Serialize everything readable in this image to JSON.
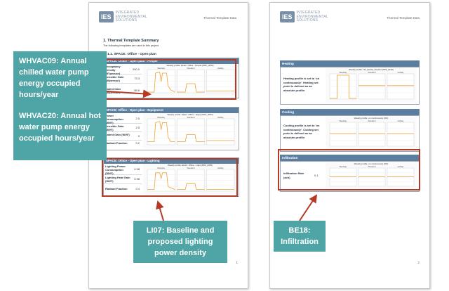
{
  "logo": {
    "mark": "IES",
    "line1": "INTEGRATED",
    "line2": "ENVIRONMENTAL",
    "line3": "SOLUTIONS"
  },
  "page1": {
    "header_right": "Thermal Template Data",
    "title": "1.  Thermal Template Summary",
    "intro": "The following templates are used in this project",
    "subheading": "1.1. SPACE: Office - Open plan",
    "page_number": "1",
    "tables": [
      {
        "title": "SPACE: Office - Open plan - People",
        "chart_title": "Weekly profile: ELEC: Office - People (PRF_0053)",
        "rows": [
          {
            "label": "Occupancy Density (ft²/person)",
            "value": "200.0"
          },
          {
            "label": "Sensible Gain (W/person)",
            "value": "73.3"
          },
          {
            "label": "Latent Gain (W/person)",
            "value": "58.6"
          }
        ]
      },
      {
        "title": "SPACE: Office - Open plan - Equipment",
        "chart_title": "Weekly profile: ELEC: Office - Equip (PRF_0054)",
        "rows": [
          {
            "label": "Power Consumption (W/ft²)",
            "value": "2.5"
          },
          {
            "label": "Sensible Gain (W/ft²)",
            "value": "2.5"
          },
          {
            "label": "Latent Gain (W/ft²)",
            "value": "0"
          },
          {
            "label": "Radiant Fraction",
            "value": "0.2"
          }
        ]
      },
      {
        "title": "SPACE: Office - Open plan - Lighting",
        "chart_title": "Weekly profile: ELEC: Office - Light (PRF_0055)",
        "rows": [
          {
            "label": "Lighting Power Consumption (W/ft²)",
            "value": "0.98"
          },
          {
            "label": "Lighting Heat Gain (W/ft²)",
            "value": "0.98"
          },
          {
            "label": "Radiant Fraction",
            "value": "0.4"
          }
        ]
      }
    ]
  },
  "page2": {
    "header_right": "Thermal Template Data",
    "page_number": "2",
    "sections": [
      {
        "title": "Heating",
        "text": "Heating profile is set to 'on continuously'. Heating set point is defined as an absolute profile:",
        "chart_title": "Weekly profile: UK_Hostel_Heatset (PRF_0193)"
      },
      {
        "title": "Cooling",
        "text": "Cooling profile is set to 'on continuously'. Cooling set point is defined as an absolute profile:",
        "chart_title": "Weekly profile: on continuously (ON)"
      },
      {
        "title": "Infiltration",
        "label": "Infiltration Rate (ach)",
        "value": "0.1",
        "chart_title": "Weekly profile: on continuously (ON)"
      }
    ]
  },
  "chart_days": [
    "Weekday",
    "Weekend",
    "Holiday"
  ],
  "callouts": {
    "whvac": [
      "WHVAC09: Annual chilled water pump energy occupied hours/year",
      "WHVAC20: Annual hot water pump energy occupied hours/year"
    ],
    "li07": "LI07: Baseline and proposed lighting power density",
    "be18": "BE18: Infiltration"
  },
  "colors": {
    "accent": "#4fa5a5",
    "frame": "#b53a26",
    "header": "#5c7e9e",
    "line": "#f0a030"
  }
}
